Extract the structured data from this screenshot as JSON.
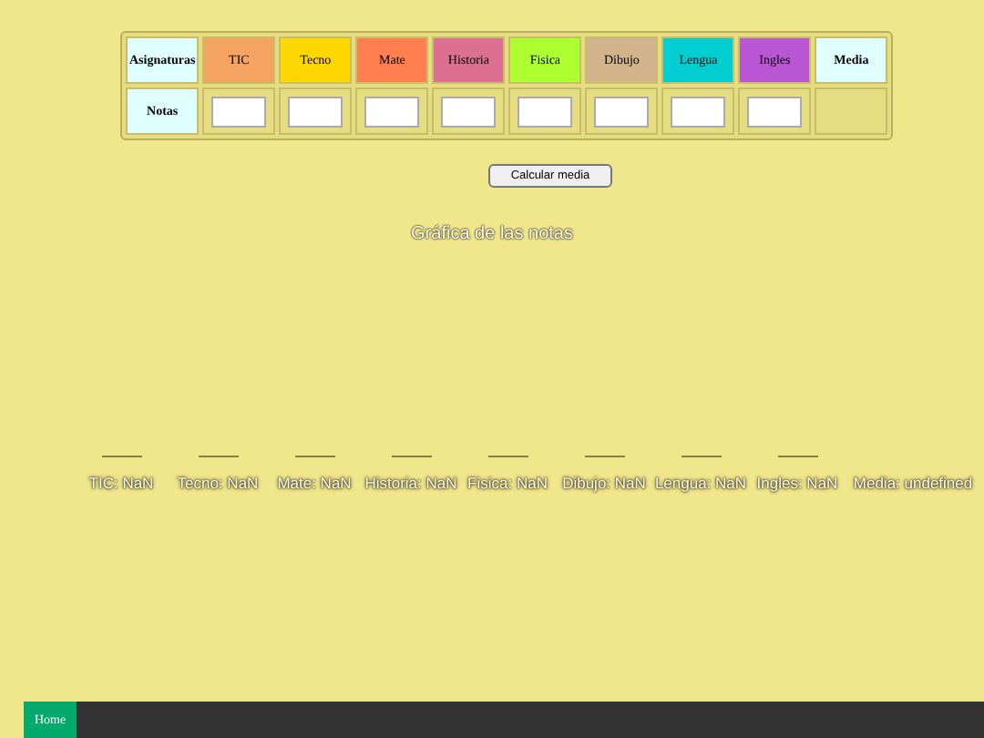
{
  "table": {
    "header_label": "Asignaturas",
    "row_label": "Notas",
    "subjects": [
      {
        "name": "TIC",
        "color": "#f4a460"
      },
      {
        "name": "Tecno",
        "color": "#ffd700"
      },
      {
        "name": "Mate",
        "color": "#ff7f50"
      },
      {
        "name": "Historia",
        "color": "#db7093"
      },
      {
        "name": "Fisica",
        "color": "#adff2f"
      },
      {
        "name": "Dibujo",
        "color": "#d2b48c"
      },
      {
        "name": "Lengua",
        "color": "#00ced1"
      },
      {
        "name": "Ingles",
        "color": "#ba55d3"
      }
    ],
    "media_label": "Media"
  },
  "button": "Calcular media",
  "chart": {
    "title": "Gráfica de las notas",
    "labels": [
      "TIC: NaN",
      "Tecno: NaN",
      "Mate: NaN",
      "Historia: NaN",
      "Fisica: NaN",
      "Dibujo: NaN",
      "Lengua: NaN",
      "Ingles: NaN"
    ],
    "media_label": "Media: undefined"
  },
  "nav": [
    {
      "label": "Home",
      "selected": true
    }
  ]
}
